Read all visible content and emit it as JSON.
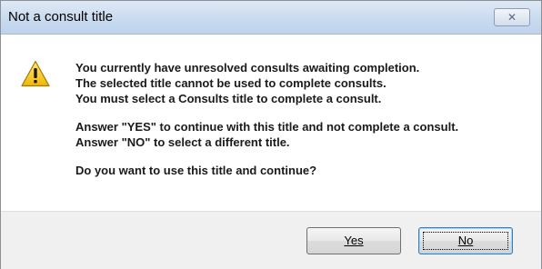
{
  "window": {
    "title": "Not a consult title",
    "close_glyph": "✕"
  },
  "icon": "warning-icon",
  "message": {
    "lines_group1": [
      "You currently have unresolved consults awaiting completion.",
      "The selected title cannot be used to complete consults.",
      "You must select a Consults title to complete a consult."
    ],
    "lines_group2": [
      "Answer \"YES\" to continue with this title and not complete a consult.",
      "Answer \"NO\" to select a different title."
    ],
    "question": "Do you want to use this title and continue?"
  },
  "buttons": {
    "yes_label": "Yes",
    "no_label": "No"
  },
  "colors": {
    "warning_fill": "#f5c518",
    "warning_outline": "#a07a00",
    "titlebar": "#c9dbef"
  }
}
